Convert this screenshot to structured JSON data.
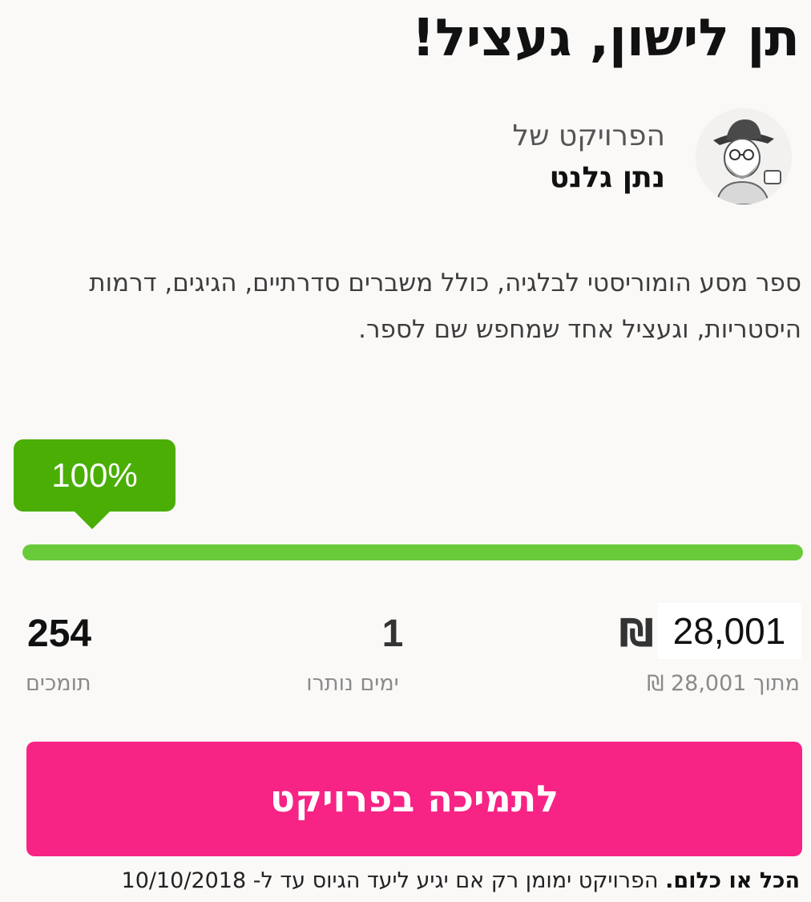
{
  "project": {
    "title": "תן לישון, געציל!",
    "owner_prefix": "הפרויקט של",
    "owner_name": "נתן גלנט",
    "description": "ספר מסע הומוריסטי לבלגיה, כולל משברים סדרתיים, הגיגים, דרמות היסטריות, וגעציל אחד שמחפש שם לספר."
  },
  "progress": {
    "percent_label": "100%",
    "fraction": 1.0
  },
  "stats": {
    "raised_amount": "28,001",
    "currency_symbol": "₪",
    "goal_text": "מתוך 28,001 ₪",
    "days_left_value": "1",
    "days_left_label": "ימים נותרו",
    "backers_value": "254",
    "backers_label": "תומכים"
  },
  "cta": {
    "label": "לתמיכה בפרויקט"
  },
  "footer": {
    "bold_text": "הכל או כלום.",
    "note_text": "הפרויקט ימומן רק אם יגיע ליעד הגיוס עד ל- 10/10/2018"
  },
  "colors": {
    "accent_pink": "#f72385",
    "progress_green": "#6acb3a",
    "bubble_green": "#4aae05"
  },
  "icons": {
    "avatar": "owner-avatar-illustration"
  }
}
